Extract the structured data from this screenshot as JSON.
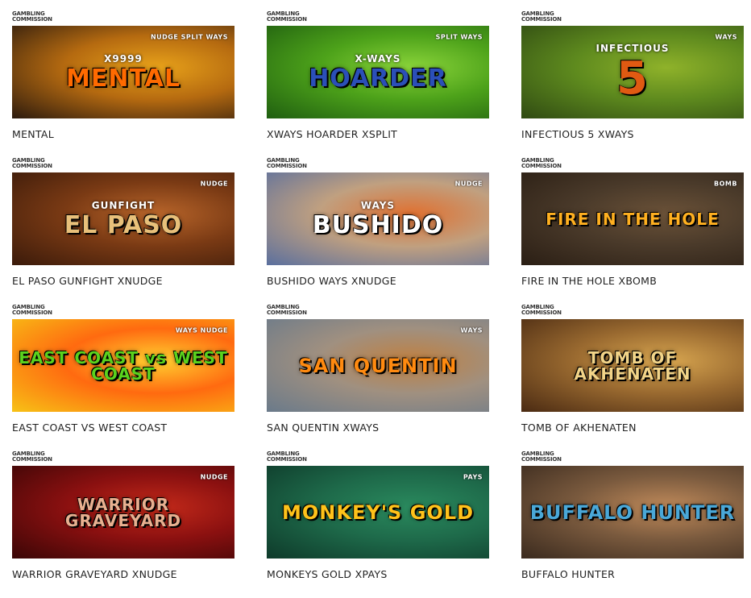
{
  "badge": {
    "line1": "GAMBLING",
    "line2": "COMMISSION"
  },
  "games": [
    {
      "name": "MENTAL",
      "art_title": "MENTAL",
      "art_sub": "X9999",
      "art_tag": "NUDGE SPLIT WAYS",
      "colors": [
        "#2b1a0e",
        "#b56a10",
        "#e8a21a"
      ],
      "title_color": "#ff6a00"
    },
    {
      "name": "XWAYS HOARDER XSPLIT",
      "art_title": "HOARDER",
      "art_sub": "X-WAYS",
      "art_tag": "SPLIT WAYS",
      "colors": [
        "#1f5e10",
        "#4da21a",
        "#8ad43a"
      ],
      "title_color": "#2b4fb8"
    },
    {
      "name": "INFECTIOUS 5 XWAYS",
      "art_title": "5",
      "art_sub": "INFECTIOUS",
      "art_tag": "WAYS",
      "colors": [
        "#2f4a12",
        "#5e8a1e",
        "#8fb22a"
      ],
      "title_color": "#e05a12"
    },
    {
      "name": "EL PASO GUNFIGHT XNUDGE",
      "art_title": "EL PASO",
      "art_sub": "GUNFIGHT",
      "art_tag": "NUDGE",
      "colors": [
        "#3a1a0a",
        "#7a3a14",
        "#b8652a"
      ],
      "title_color": "#e8c07a"
    },
    {
      "name": "BUSHIDO WAYS XNUDGE",
      "art_title": "BUSHIDO",
      "art_sub": "WAYS",
      "art_tag": "NUDGE",
      "colors": [
        "#5a6f9e",
        "#c0a080",
        "#e07030"
      ],
      "title_color": "#ffffff"
    },
    {
      "name": "FIRE IN THE HOLE XBOMB",
      "art_title": "FIRE IN THE HOLE",
      "art_sub": "",
      "art_tag": "BOMB",
      "colors": [
        "#2a1e14",
        "#4a3a2a",
        "#6b5238"
      ],
      "title_color": "#ffb020"
    },
    {
      "name": "EAST COAST VS WEST COAST",
      "art_title": "EAST COAST vs WEST COAST",
      "art_sub": "",
      "art_tag": "WAYS NUDGE",
      "colors": [
        "#f7c216",
        "#ff6a10",
        "#ffd030"
      ],
      "title_color": "#5ad21e"
    },
    {
      "name": "SAN QUENTIN XWAYS",
      "art_title": "SAN QUENTIN",
      "art_sub": "",
      "art_tag": "WAYS",
      "colors": [
        "#6a7a8a",
        "#a09080",
        "#c08040"
      ],
      "title_color": "#ff8a10"
    },
    {
      "name": "TOMB OF AKHENATEN",
      "art_title": "TOMB OF AKHENATEN",
      "art_sub": "",
      "art_tag": "",
      "colors": [
        "#4a2a12",
        "#9a6a30",
        "#d8a650"
      ],
      "title_color": "#f2d488"
    },
    {
      "name": "WARRIOR GRAVEYARD XNUDGE",
      "art_title": "WARRIOR GRAVEYARD",
      "art_sub": "",
      "art_tag": "NUDGE",
      "colors": [
        "#3a0606",
        "#8a1010",
        "#c42a1a"
      ],
      "title_color": "#e8b090"
    },
    {
      "name": "MONKEYS GOLD XPAYS",
      "art_title": "MONKEY'S GOLD",
      "art_sub": "",
      "art_tag": "PAYS",
      "colors": [
        "#0e3a2a",
        "#1e6a4a",
        "#2a8a5e"
      ],
      "title_color": "#ffc21a"
    },
    {
      "name": "BUFFALO HUNTER",
      "art_title": "BUFFALO HUNTER",
      "art_sub": "",
      "art_tag": "",
      "colors": [
        "#3a2a1e",
        "#7a5a3e",
        "#c08a5a"
      ],
      "title_color": "#4aa8d8"
    }
  ]
}
